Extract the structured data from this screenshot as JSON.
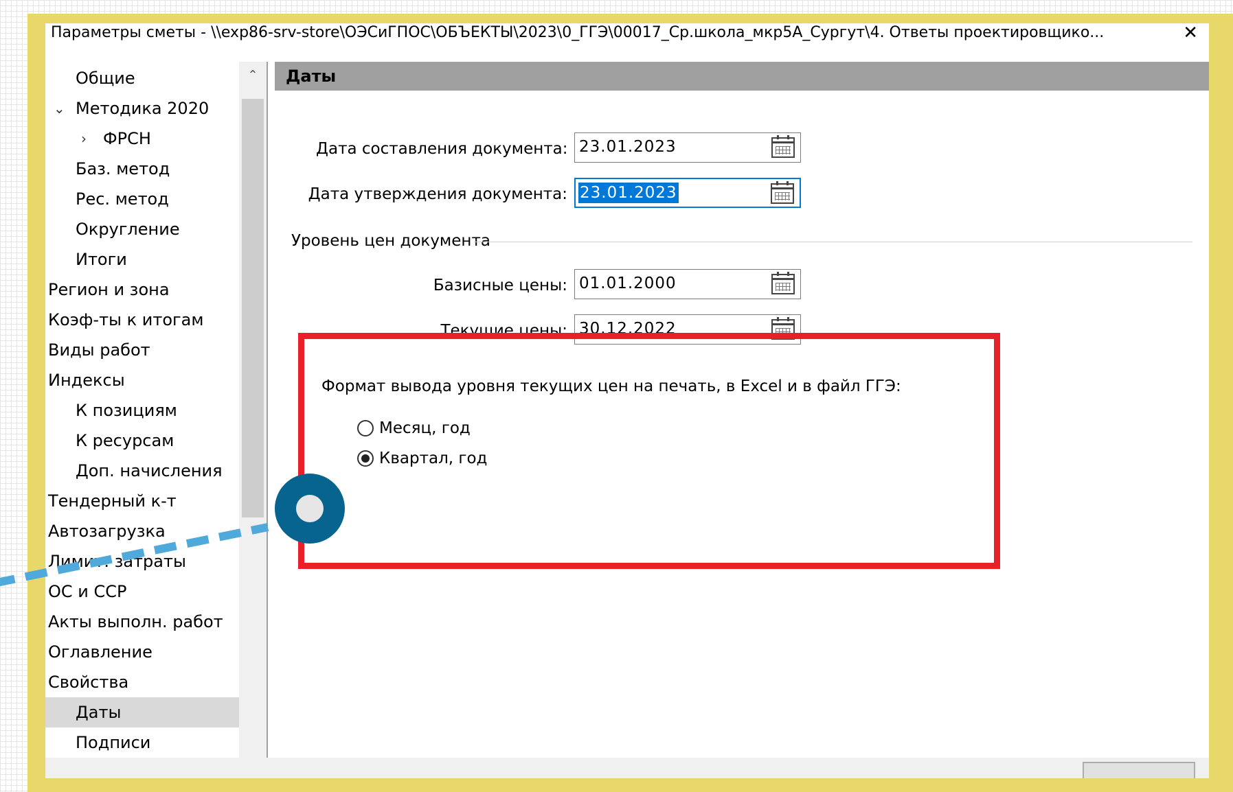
{
  "window": {
    "title": "Параметры сметы - \\\\exp86-srv-store\\ОЭСиГПОС\\ОБЪЕКТЫ\\2023\\0_ГГЭ\\00017_Ср.школа_мкр5А_Сургут\\4. Ответы проектировщико...",
    "close_glyph": "✕"
  },
  "sidebar": {
    "items": [
      {
        "label": "Общие",
        "level": 1
      },
      {
        "label": "Методика 2020",
        "level": 1,
        "arrow": "⌄"
      },
      {
        "label": "ФРСН",
        "level": 2,
        "arrow": "›"
      },
      {
        "label": "Баз. метод",
        "level": 1
      },
      {
        "label": "Рес. метод",
        "level": 1
      },
      {
        "label": "Округление",
        "level": 1
      },
      {
        "label": "Итоги",
        "level": 1
      },
      {
        "label": "Регион и зона",
        "level": 0
      },
      {
        "label": "Коэф-ты к итогам",
        "level": 0
      },
      {
        "label": "Виды работ",
        "level": 0
      },
      {
        "label": "Индексы",
        "level": 0
      },
      {
        "label": "К позициям",
        "level": 1
      },
      {
        "label": "К ресурсам",
        "level": 1
      },
      {
        "label": "Доп. начисления",
        "level": 1
      },
      {
        "label": "Тендерный к-т",
        "level": 0
      },
      {
        "label": "Автозагрузка",
        "level": 0
      },
      {
        "label": "Лимит. затраты",
        "level": 0
      },
      {
        "label": "ОС и ССР",
        "level": 0
      },
      {
        "label": "Акты выполн. работ",
        "level": 0
      },
      {
        "label": "Оглавление",
        "level": 0
      },
      {
        "label": "Свойства",
        "level": 0
      },
      {
        "label": "Даты",
        "level": 1,
        "selected": true
      },
      {
        "label": "Подписи",
        "level": 1
      }
    ],
    "scroll_up": "⌃",
    "scroll_down": "⌄"
  },
  "main": {
    "section_title": "Даты",
    "doc_date_label": "Дата составления документа:",
    "doc_date_value": "23.01.2023",
    "approve_date_label": "Дата утверждения документа:",
    "approve_date_value": "23.01.2023",
    "price_level_title": "Уровень цен документа",
    "base_prices_label": "Базисные цены:",
    "base_prices_value": "01.01.2000",
    "current_prices_label": "Текущие цены:",
    "current_prices_value": "30.12.2022",
    "format_title": "Формат вывода уровня текущих цен на печать, в Excel и в файл ГГЭ:",
    "option_month_year": "Месяц, год",
    "option_quarter_year": "Квартал, год",
    "selected_option": "Квартал, год"
  },
  "colors": {
    "frame": "#e8d86a",
    "highlight_box": "#e8202a",
    "marker": "#06648f",
    "dashed_line": "#4fa9db",
    "section_header": "#a0a0a0",
    "selection": "#0078d7"
  },
  "icons": [
    "calendar-icon",
    "close-icon",
    "chevron-down-icon",
    "chevron-right-icon",
    "radio-button"
  ]
}
